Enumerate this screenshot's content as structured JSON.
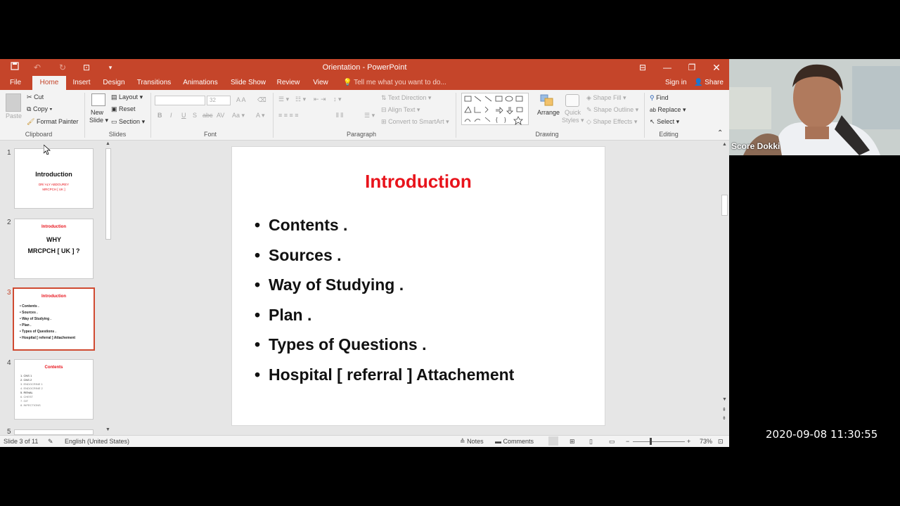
{
  "window": {
    "title": "Orientation - PowerPoint",
    "tell_me": "Tell me what you want to do...",
    "sign_in": "Sign in",
    "share": "Share"
  },
  "tabs": [
    "File",
    "Home",
    "Insert",
    "Design",
    "Transitions",
    "Animations",
    "Slide Show",
    "Review",
    "View"
  ],
  "active_tab": "Home",
  "ribbon": {
    "clipboard": {
      "paste": "Paste",
      "cut": "Cut",
      "copy": "Copy",
      "format_painter": "Format Painter",
      "label": "Clipboard"
    },
    "slides": {
      "new_slide_line1": "New",
      "new_slide_line2": "Slide",
      "layout": "Layout",
      "reset": "Reset",
      "section": "Section",
      "label": "Slides"
    },
    "font": {
      "size": "32",
      "label": "Font"
    },
    "paragraph": {
      "text_direction": "Text Direction",
      "align_text": "Align Text",
      "convert_smartart": "Convert to SmartArt",
      "label": "Paragraph"
    },
    "drawing": {
      "arrange": "Arrange",
      "quick_styles_line1": "Quick",
      "quick_styles_line2": "Styles",
      "shape_fill": "Shape Fill",
      "shape_outline": "Shape Outline",
      "shape_effects": "Shape Effects",
      "label": "Drawing"
    },
    "editing": {
      "find": "Find",
      "replace": "Replace",
      "select": "Select",
      "label": "Editing"
    }
  },
  "thumbnails": [
    {
      "num": "1",
      "title": "Introduction",
      "subtitle_lines": [
        "DR/ ALY ABDOUREY",
        "MRCPCH [ UK ]"
      ]
    },
    {
      "num": "2",
      "header": "Introduction",
      "body_lines": [
        "WHY",
        "MRCPCH [ UK ] ?"
      ]
    },
    {
      "num": "3",
      "header": "Introduction",
      "lines": [
        "• Contents .",
        "• Sources .",
        "• Way of  Studying .",
        "• Plan .",
        "• Types of Questions .",
        "• Hospital  [ referral ] Attachement"
      ]
    },
    {
      "num": "4",
      "header": "Contents",
      "lines": [
        "1. CNS 1",
        "2. CNS 2",
        "3. ENDOCRINE 1",
        "4. ENDOCRINE 2",
        "5. RENAL",
        "6. CHEST",
        "7. GIT",
        "8. INFECTIONS"
      ]
    },
    {
      "num": "5"
    }
  ],
  "slide": {
    "title": "Introduction",
    "bullets": [
      "Contents .",
      "Sources .",
      "Way of  Studying .",
      "Plan .",
      "Types of Questions .",
      "Hospital  [ referral ] Attachement"
    ]
  },
  "status": {
    "slide_of": "Slide 3 of 11",
    "language": "English (United States)",
    "notes": "Notes",
    "comments": "Comments",
    "zoom": "73%"
  },
  "webcam": {
    "name": "Score Dokki"
  },
  "timestamp": "2020-09-08 11:30:55",
  "colors": {
    "accent": "#c5452a",
    "slide_title": "#e8131b"
  }
}
